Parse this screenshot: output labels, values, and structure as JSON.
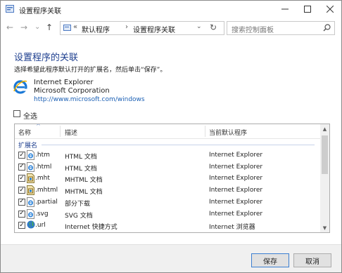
{
  "window": {
    "title": "设置程序关联"
  },
  "nav": {
    "back_glyph": "←",
    "forward_glyph": "→",
    "recent_glyph": "⌄",
    "up_glyph": "↑",
    "address": {
      "overflow": "«",
      "crumbs": [
        "默认程序",
        "设置程序关联"
      ],
      "separator": "›"
    },
    "search_placeholder": "搜索控制面板"
  },
  "content": {
    "title": "设置程序的关联",
    "instruction": "选择希望此程序默认打开的扩展名，然后单击“保存”。",
    "program": {
      "name": "Internet Explorer",
      "company": "Microsoft Corporation",
      "url": "http://www.microsoft.com/windows"
    },
    "select_all_label": "全选"
  },
  "list": {
    "columns": [
      "名称",
      "描述",
      "当前默认程序"
    ],
    "group": "扩展名",
    "rows": [
      {
        "ext": ".htm",
        "desc": "HTML 文档",
        "program": "Internet Explorer",
        "checked": true,
        "icon": "ie-document-icon"
      },
      {
        "ext": ".html",
        "desc": "HTML 文档",
        "program": "Internet Explorer",
        "checked": true,
        "icon": "ie-document-icon"
      },
      {
        "ext": ".mht",
        "desc": "MHTML 文档",
        "program": "Internet Explorer",
        "checked": true,
        "icon": "mhtml-document-icon"
      },
      {
        "ext": ".mhtml",
        "desc": "MHTML 文档",
        "program": "Internet Explorer",
        "checked": true,
        "icon": "mhtml-document-icon"
      },
      {
        "ext": ".partial",
        "desc": "部分下载",
        "program": "Internet Explorer",
        "checked": true,
        "icon": "ie-document-icon"
      },
      {
        "ext": ".svg",
        "desc": "SVG 文档",
        "program": "Internet Explorer",
        "checked": true,
        "icon": "ie-document-icon"
      },
      {
        "ext": ".url",
        "desc": "Internet 快捷方式",
        "program": "Internet 浏览器",
        "checked": true,
        "icon": "globe-icon"
      }
    ]
  },
  "buttons": {
    "save": "保存",
    "cancel": "取消"
  }
}
